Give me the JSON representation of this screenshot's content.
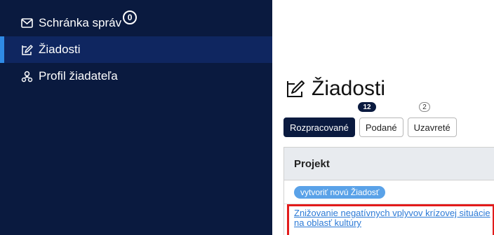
{
  "sidebar": {
    "items": [
      {
        "label": "Schránka správ",
        "icon": "envelope-icon",
        "badge": "0",
        "active": false
      },
      {
        "label": "Žiadosti",
        "icon": "edit-document-icon",
        "active": true
      },
      {
        "label": "Profil žiadateľa",
        "icon": "user-group-icon",
        "active": false
      }
    ]
  },
  "main": {
    "title": "Žiadosti",
    "title_icon": "edit-document-icon",
    "tabs": [
      {
        "label": "Rozpracované",
        "count": "12",
        "active": true
      },
      {
        "label": "Podané",
        "count": "2",
        "active": false
      },
      {
        "label": "Uzavreté",
        "active": false
      }
    ],
    "table": {
      "column_header": "Projekt",
      "create_button": "vytvoriť novú Žiadosť",
      "rows": [
        {
          "project": "Znižovanie negatívnych vplyvov krízovej situácie na oblasť kultúry"
        }
      ]
    }
  },
  "colors": {
    "sidebar_bg": "#0a1a3f",
    "active_bg": "#0f2660",
    "active_accent": "#2f8be6",
    "link": "#2c7ad6",
    "highlight": "#e21b1b"
  }
}
